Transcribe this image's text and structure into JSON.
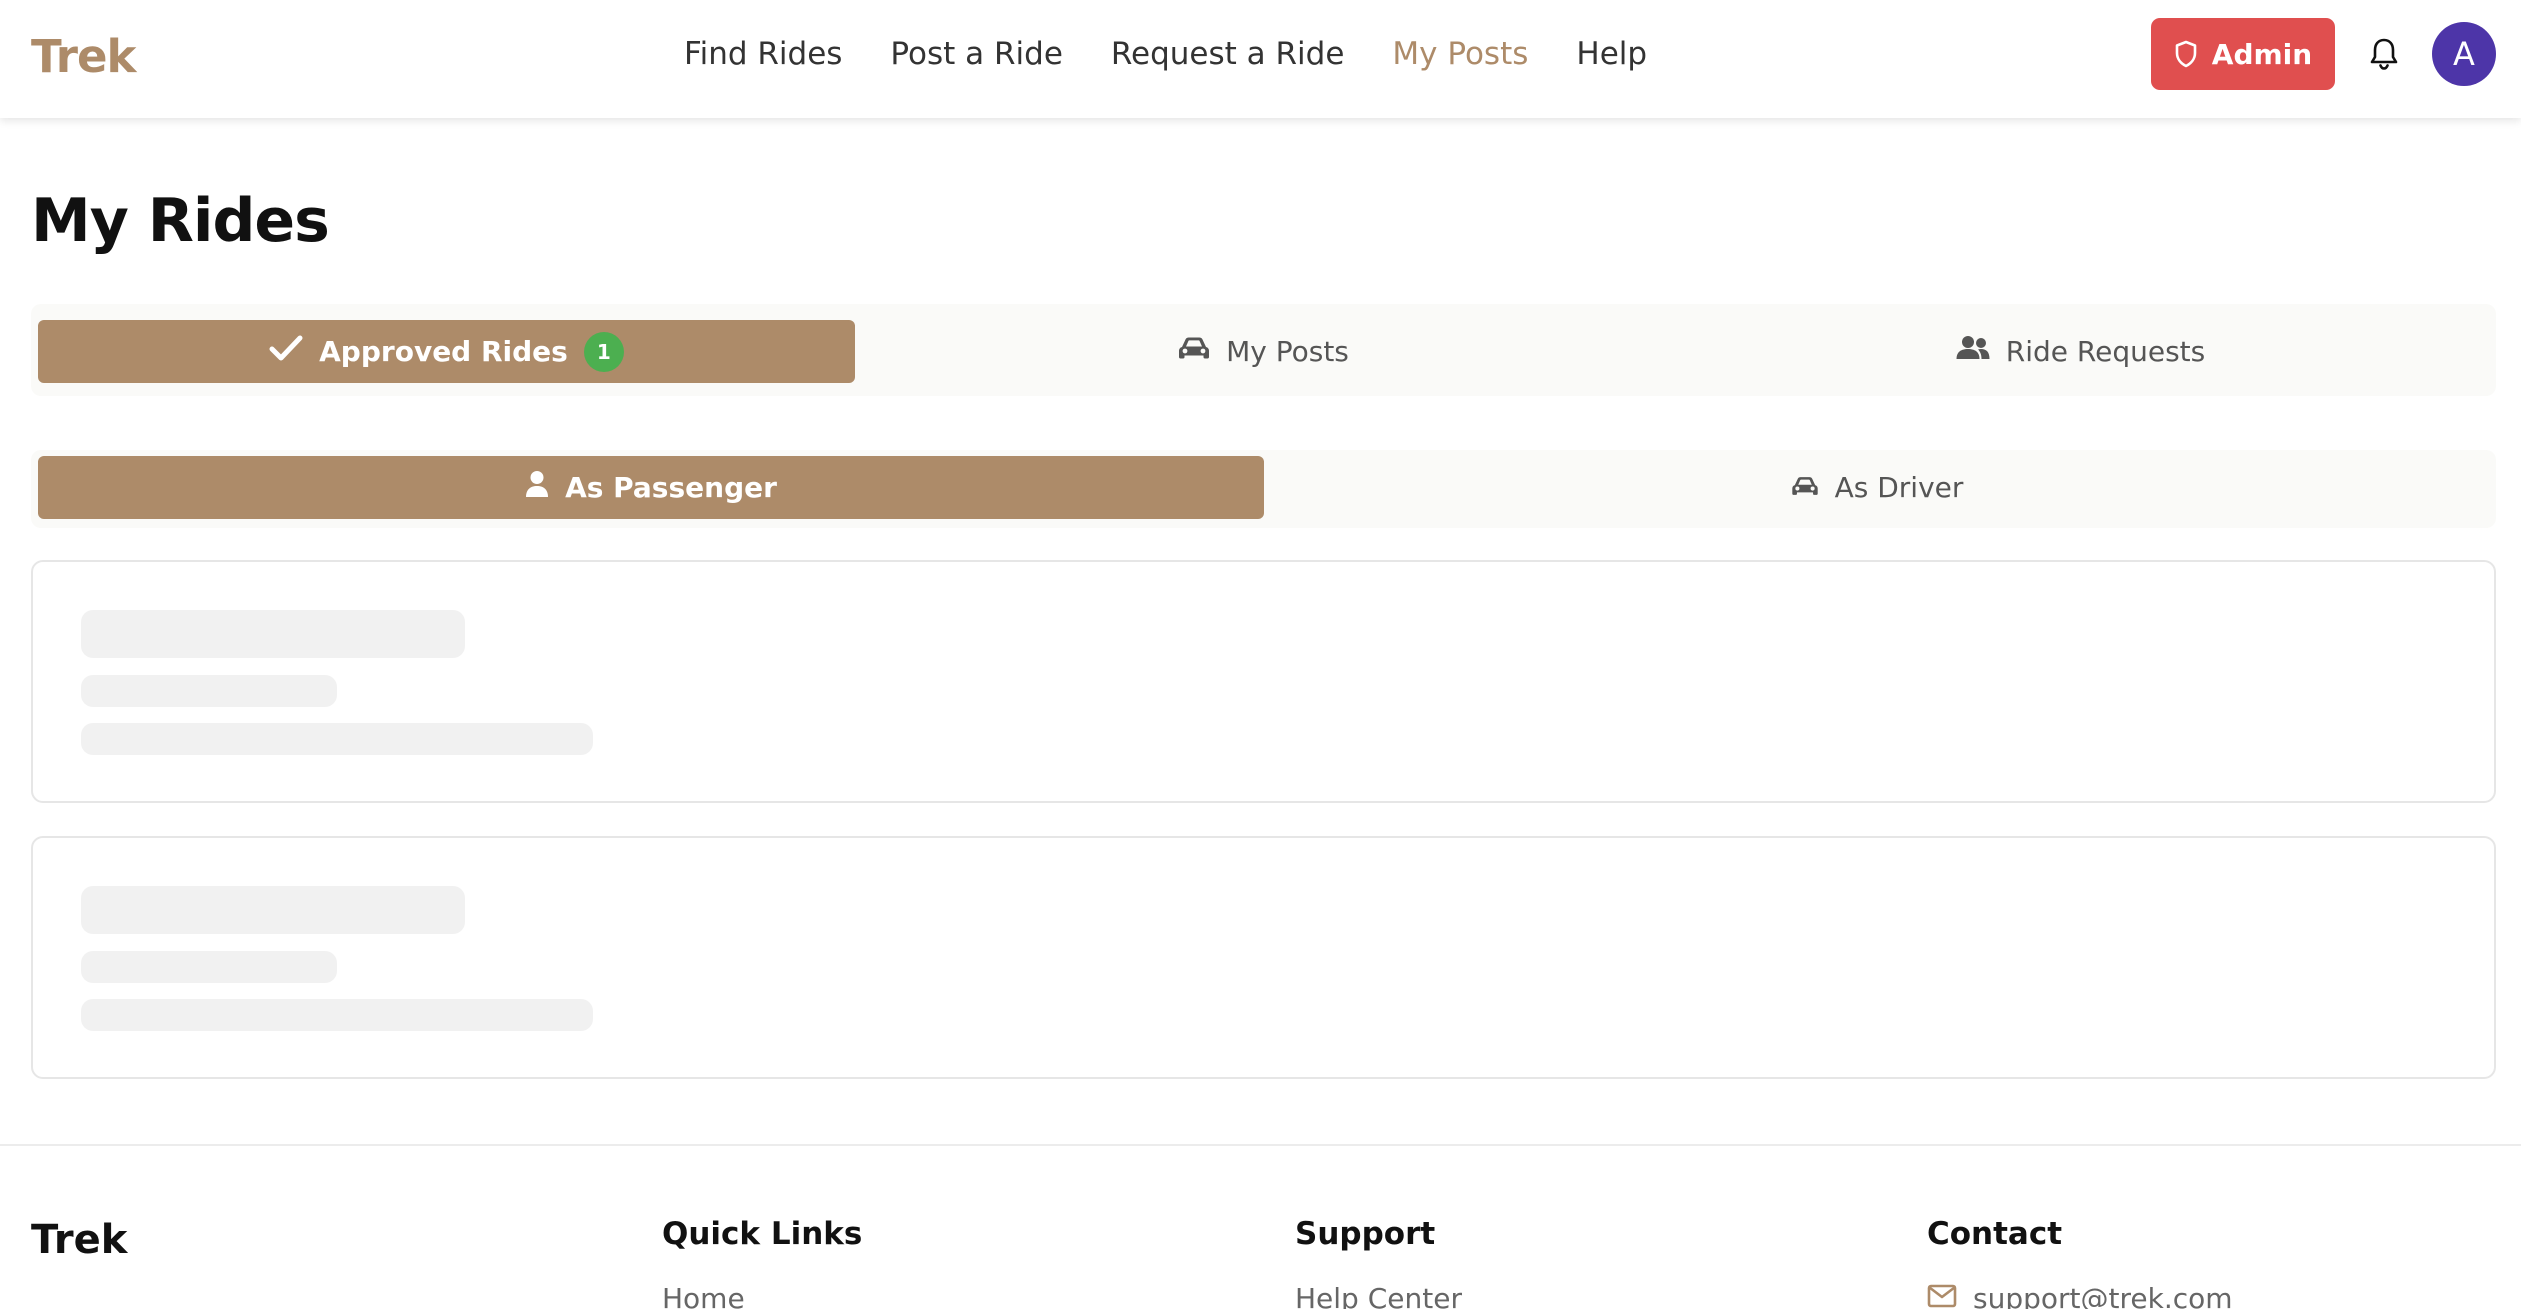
{
  "header": {
    "logo": "Trek",
    "nav": [
      {
        "label": "Find Rides",
        "active": false
      },
      {
        "label": "Post a Ride",
        "active": false
      },
      {
        "label": "Request a Ride",
        "active": false
      },
      {
        "label": "My Posts",
        "active": true
      },
      {
        "label": "Help",
        "active": false
      }
    ],
    "admin_label": "Admin",
    "admin_icon": "shield-icon",
    "notification_icon": "bell-icon",
    "avatar_initial": "A"
  },
  "page": {
    "title": "My Rides"
  },
  "tabs": [
    {
      "label": "Approved Rides",
      "icon": "check-icon",
      "badge": "1",
      "active": true
    },
    {
      "label": "My Posts",
      "icon": "car-icon",
      "active": false
    },
    {
      "label": "Ride Requests",
      "icon": "users-icon",
      "active": false
    }
  ],
  "subtabs": [
    {
      "label": "As Passenger",
      "icon": "user-icon",
      "active": true
    },
    {
      "label": "As Driver",
      "icon": "car-icon",
      "active": false
    }
  ],
  "loading_cards": 2,
  "footer": {
    "logo": "Trek",
    "columns": [
      {
        "heading": "Quick Links",
        "first_item": "Home"
      },
      {
        "heading": "Support",
        "first_item": "Help Center"
      },
      {
        "heading": "Contact",
        "first_item": "support@trek.com",
        "first_item_icon": "mail-icon"
      }
    ]
  },
  "colors": {
    "brand": "#ad8b69",
    "admin": "#e04f4f",
    "avatar": "#4d35a8",
    "badge": "#4caf50"
  }
}
